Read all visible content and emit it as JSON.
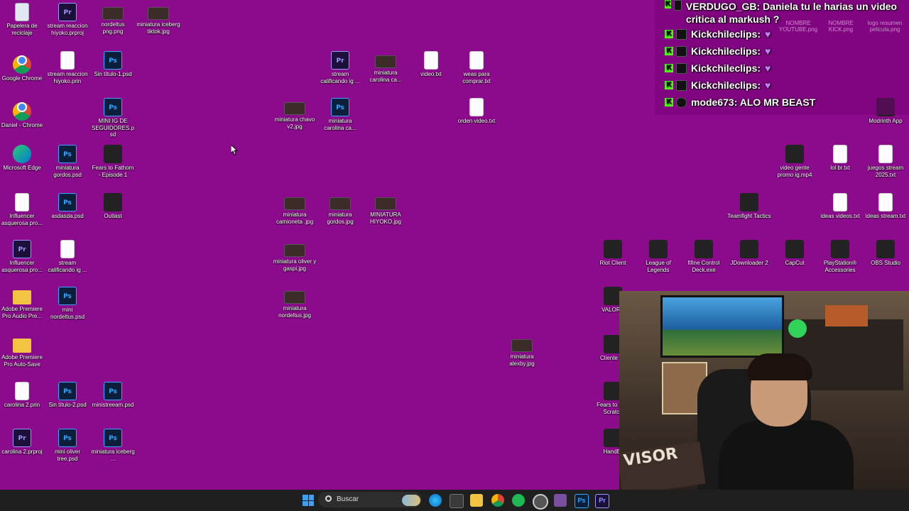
{
  "desktop": {
    "icons": [
      {
        "label": "Papelera de reciclaje",
        "kind": "bin",
        "glyph": "",
        "pos": "c0r0"
      },
      {
        "label": "stream reaccion hiyoko.prproj",
        "kind": "pr",
        "glyph": "Pr",
        "pos": "c1r0"
      },
      {
        "label": "nordeltus png.png",
        "kind": "img",
        "glyph": "",
        "pos": "c2r0"
      },
      {
        "label": "miniatura iceberg tiktok.jpg",
        "kind": "img",
        "glyph": "",
        "pos": "c3r0"
      },
      {
        "label": "Google Chrome",
        "kind": "chrome",
        "glyph": "",
        "pos": "c0r1"
      },
      {
        "label": "stream reaccion hiyoko.prin",
        "kind": "txt",
        "glyph": "",
        "pos": "c1r1"
      },
      {
        "label": "Sin título-1.psd",
        "kind": "ps",
        "glyph": "Ps",
        "pos": "c2r1"
      },
      {
        "label": "stream calificando ig ...",
        "kind": "pr",
        "glyph": "Pr",
        "pos": "m0r1"
      },
      {
        "label": "miniatura carolina ca...",
        "kind": "img",
        "glyph": "",
        "pos": "m1r1"
      },
      {
        "label": "video.txt",
        "kind": "txt",
        "glyph": "",
        "pos": "m2r1"
      },
      {
        "label": "weas para comprar.txt",
        "kind": "txt",
        "glyph": "",
        "pos": "m3r1"
      },
      {
        "label": "Daniel - Chrome",
        "kind": "chrome",
        "glyph": "",
        "pos": "c0r2"
      },
      {
        "label": "MINI IG DE SEGUIDORES.psd",
        "kind": "ps",
        "glyph": "Ps",
        "pos": "c2r2"
      },
      {
        "label": "miniatura chavo v2.jpg",
        "kind": "img",
        "glyph": "",
        "pos": "n0r2"
      },
      {
        "label": "miniatura carolina ca...",
        "kind": "ps",
        "glyph": "Ps",
        "pos": "m0r2"
      },
      {
        "label": "orden video.txt",
        "kind": "txt",
        "glyph": "",
        "pos": "m3r2"
      },
      {
        "label": "Microsoft Edge",
        "kind": "edge",
        "glyph": "",
        "pos": "c0r3"
      },
      {
        "label": "miniatura gordos.psd",
        "kind": "ps",
        "glyph": "Ps",
        "pos": "c1r3"
      },
      {
        "label": "Fears to Fathom - Episode 1",
        "kind": "app",
        "glyph": "",
        "pos": "c2r3"
      },
      {
        "label": "Influencer asquerosa pro...",
        "kind": "txt",
        "glyph": "",
        "pos": "c0r4"
      },
      {
        "label": "asdasda.psd",
        "kind": "ps",
        "glyph": "Ps",
        "pos": "c1r4"
      },
      {
        "label": "Outlast",
        "kind": "app",
        "glyph": "",
        "pos": "c2r4"
      },
      {
        "label": "miniatura camioneta .jpg",
        "kind": "img",
        "glyph": "",
        "pos": "n0r4"
      },
      {
        "label": "miniatura gordos.jpg",
        "kind": "img",
        "glyph": "",
        "pos": "m0r4"
      },
      {
        "label": "MINIATURA HIYOKO.jpg",
        "kind": "img",
        "glyph": "",
        "pos": "m1r4"
      },
      {
        "label": "Influencer asquerosa pro...",
        "kind": "pr",
        "glyph": "Pr",
        "pos": "c0r5"
      },
      {
        "label": "stream calificando ig ...",
        "kind": "txt",
        "glyph": "",
        "pos": "c1r5"
      },
      {
        "label": "miniatura oliver y gaspi.jpg",
        "kind": "img",
        "glyph": "",
        "pos": "n0r5"
      },
      {
        "label": "Adobe Premiere Pro Audio Pre...",
        "kind": "folder",
        "glyph": "",
        "pos": "c0r6"
      },
      {
        "label": "mini nordeltus.psd",
        "kind": "ps",
        "glyph": "Ps",
        "pos": "c1r6"
      },
      {
        "label": "miniatura nordeltus.jpg",
        "kind": "img",
        "glyph": "",
        "pos": "n0r6"
      },
      {
        "label": "Adobe Premiere Pro Auto-Save",
        "kind": "folder",
        "glyph": "",
        "pos": "c0r7"
      },
      {
        "label": "miniatura alexby.jpg",
        "kind": "img",
        "glyph": "",
        "pos": "a0r7"
      },
      {
        "label": "carolina 2.prin",
        "kind": "txt",
        "glyph": "",
        "pos": "c0r8"
      },
      {
        "label": "Sin título-2.psd",
        "kind": "ps",
        "glyph": "Ps",
        "pos": "c1r8"
      },
      {
        "label": "ministreeam.psd",
        "kind": "ps",
        "glyph": "Ps",
        "pos": "c2r8"
      },
      {
        "label": "carolina 2.prproj",
        "kind": "pr",
        "glyph": "Pr",
        "pos": "c0r9"
      },
      {
        "label": "mini oliver tree.psd",
        "kind": "ps",
        "glyph": "Ps",
        "pos": "c1r9"
      },
      {
        "label": "miniatura iceberg ...",
        "kind": "ps",
        "glyph": "Ps",
        "pos": "c2r9"
      },
      {
        "label": "Modrinth App",
        "kind": "app",
        "glyph": "",
        "pos": "rA2"
      },
      {
        "label": "video gente promo ig.mp4",
        "kind": "app",
        "glyph": "",
        "pos": "rB3"
      },
      {
        "label": "lol br.txt",
        "kind": "txt",
        "glyph": "",
        "pos": "rC3"
      },
      {
        "label": "juegos stream 2025.txt",
        "kind": "txt",
        "glyph": "",
        "pos": "rD3"
      },
      {
        "label": "Teamfight Tactics",
        "kind": "app",
        "glyph": "",
        "pos": "rE4"
      },
      {
        "label": "ideas videos.txt",
        "kind": "txt",
        "glyph": "",
        "pos": "rC4"
      },
      {
        "label": "ideas stream.txt",
        "kind": "txt",
        "glyph": "",
        "pos": "rD4"
      },
      {
        "label": "Riot Client",
        "kind": "app",
        "glyph": "",
        "pos": "rF5"
      },
      {
        "label": "League of Legends",
        "kind": "app",
        "glyph": "",
        "pos": "rG5"
      },
      {
        "label": "fifine Control Deck.exe",
        "kind": "app",
        "glyph": "",
        "pos": "rH5"
      },
      {
        "label": "JDownloader 2",
        "kind": "app",
        "glyph": "",
        "pos": "rE5"
      },
      {
        "label": "CapCut",
        "kind": "app",
        "glyph": "",
        "pos": "rB5"
      },
      {
        "label": "PlayStation® Accessories",
        "kind": "app",
        "glyph": "",
        "pos": "rC5"
      },
      {
        "label": "OBS Studio",
        "kind": "app",
        "glyph": "",
        "pos": "rD5"
      },
      {
        "label": "VALORA",
        "kind": "app",
        "glyph": "",
        "pos": "rF6"
      },
      {
        "label": "Cliente de",
        "kind": "app",
        "glyph": "",
        "pos": "rF7"
      },
      {
        "label": "Fears to Fa - Scratch",
        "kind": "app",
        "glyph": "",
        "pos": "rF8"
      },
      {
        "label": "HandBr",
        "kind": "app",
        "glyph": "",
        "pos": "rF9"
      }
    ]
  },
  "chat": {
    "messages": [
      {
        "text": "VERDUGO_GB: Daniela tu le harias un video critica al markush ?"
      },
      {
        "text": "Kickchileclips:"
      },
      {
        "text": "Kickchileclips:"
      },
      {
        "text": "Kickchileclips:"
      },
      {
        "text": "Kickchileclips:"
      },
      {
        "text": "mode673: ALO MR BEAST"
      }
    ]
  },
  "overlay_ghost": {
    "label1": "NOMBRE YOUTUBE.png",
    "label2": "NOMBRE KICK.png",
    "label3": "logo resumen pelicula.png"
  },
  "webcam": {
    "sign_text": "VISOR"
  },
  "taskbar": {
    "search_placeholder": "Buscar"
  },
  "colors": {
    "desktop_bg": "#8c0a8c",
    "kick_green": "#53fc18",
    "taskbar": "#1f1f1f"
  }
}
